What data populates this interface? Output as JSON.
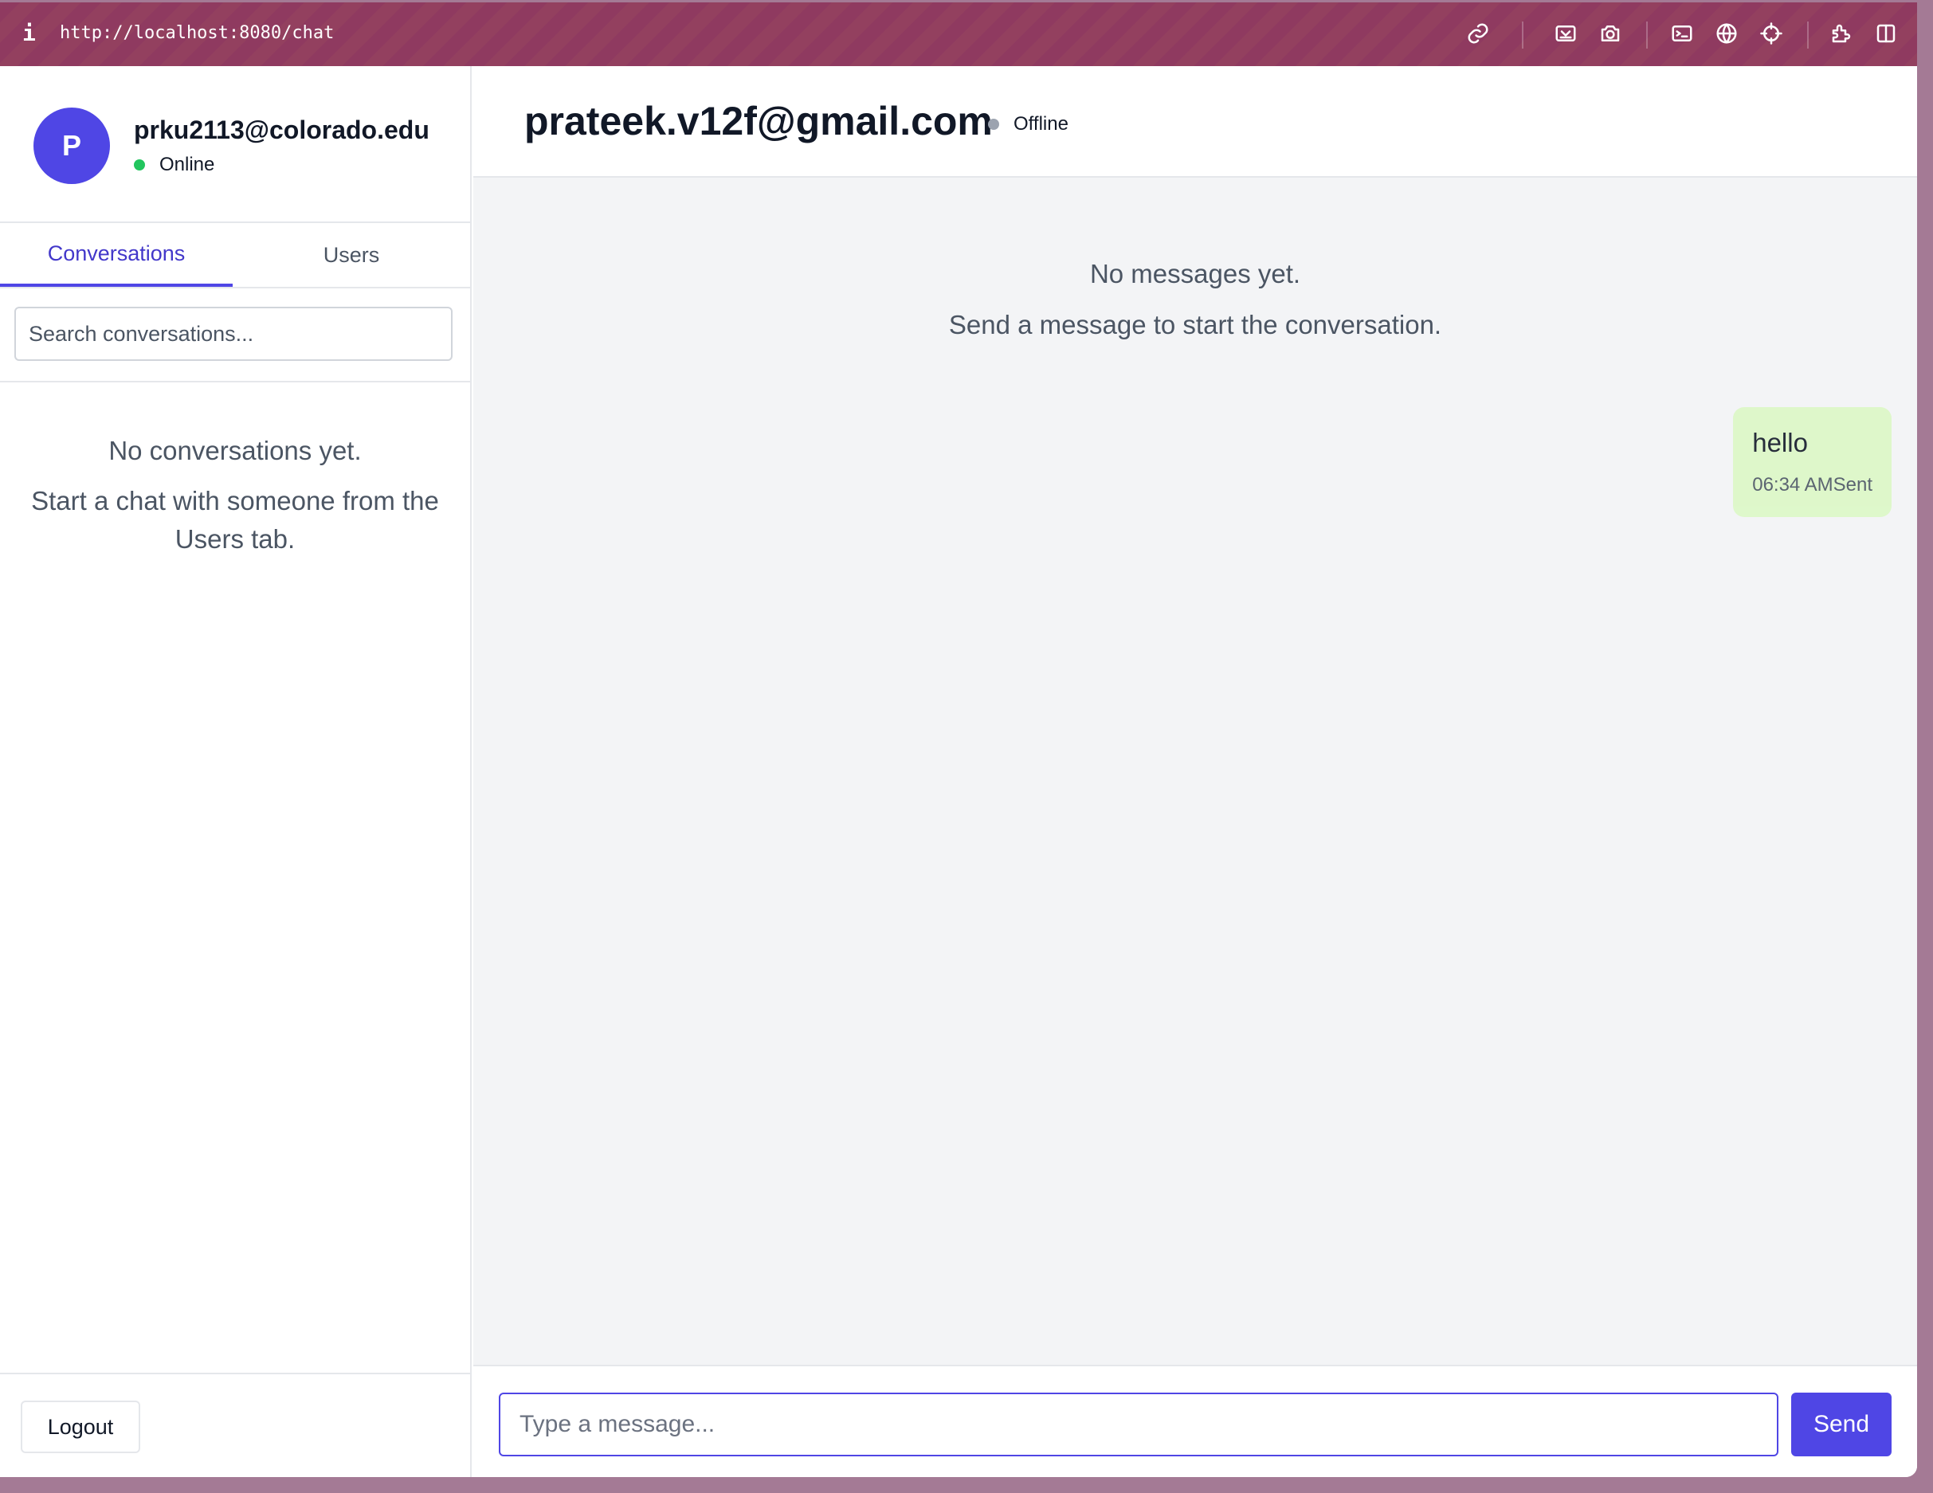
{
  "browser": {
    "info_icon": "i",
    "url": "http://localhost:8080/chat",
    "toolbar_icons": [
      "link-icon",
      "screencast-icon",
      "camera-icon",
      "terminal-icon",
      "globe-icon",
      "crosshair-icon",
      "extensions-icon",
      "split-view-icon"
    ]
  },
  "current_user": {
    "avatar_letter": "P",
    "email": "prku2113@colorado.edu",
    "status": "Online",
    "status_color": "#22c55e"
  },
  "tabs": [
    {
      "label": "Conversations",
      "active": true
    },
    {
      "label": "Users",
      "active": false
    }
  ],
  "search": {
    "placeholder": "Search conversations...",
    "value": ""
  },
  "sidebar_empty": {
    "line1": "No conversations yet.",
    "line2": "Start a chat with someone from the Users tab."
  },
  "logout_label": "Logout",
  "chat": {
    "peer_email": "prateek.v12f@gmail.com",
    "peer_status": "Offline",
    "peer_status_color": "#9ca3af",
    "empty_line1": "No messages yet.",
    "empty_line2": "Send a message to start the conversation.",
    "messages": [
      {
        "text": "hello",
        "time": "06:34 AM",
        "status": "Sent"
      }
    ]
  },
  "composer": {
    "placeholder": "Type a message...",
    "value": "",
    "send_label": "Send"
  },
  "colors": {
    "accent": "#4f46e5",
    "bubble": "#dcf8c6",
    "toolbar": "#8f3a60"
  }
}
